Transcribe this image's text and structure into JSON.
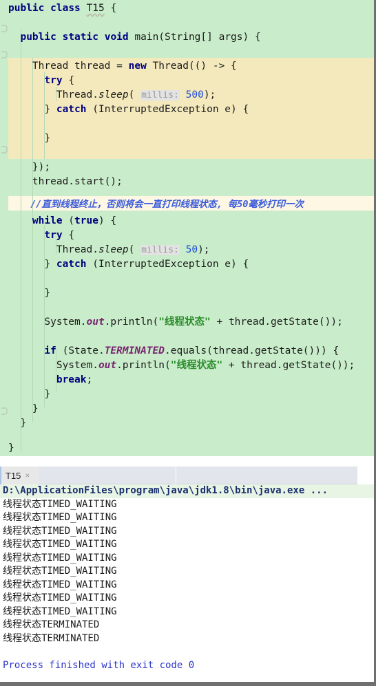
{
  "editor": {
    "background_color": "#c9ecca",
    "lambda_highlight_color": "#f4e9bd",
    "caret_line_color": "#fdf7e3",
    "lines": [
      {
        "id": "l1",
        "text": "public class T15 {"
      },
      {
        "id": "l2",
        "text": ""
      },
      {
        "id": "l3",
        "text": "  public static void main(String[] args) {"
      },
      {
        "id": "l4",
        "text": ""
      },
      {
        "id": "l5",
        "text": "    Thread thread = new Thread(() -> {"
      },
      {
        "id": "l6",
        "text": "      try {"
      },
      {
        "id": "l7",
        "text": "        Thread.sleep( millis: 500);"
      },
      {
        "id": "l8",
        "text": "      } catch (InterruptedException e) {"
      },
      {
        "id": "l9",
        "text": ""
      },
      {
        "id": "l10",
        "text": "      }"
      },
      {
        "id": "l11",
        "text": ""
      },
      {
        "id": "l12",
        "text": "    });"
      },
      {
        "id": "l13",
        "text": "    thread.start();"
      },
      {
        "id": "l14",
        "text": ""
      },
      {
        "id": "l15",
        "text": "    //直到线程终止，否则将会一直打印线程状态, 每50毫秒打印一次"
      },
      {
        "id": "l16",
        "text": "    while (true) {"
      },
      {
        "id": "l17",
        "text": "      try {"
      },
      {
        "id": "l18",
        "text": "        Thread.sleep( millis: 50);"
      },
      {
        "id": "l19",
        "text": "      } catch (InterruptedException e) {"
      },
      {
        "id": "l20",
        "text": ""
      },
      {
        "id": "l21",
        "text": "      }"
      },
      {
        "id": "l22",
        "text": ""
      },
      {
        "id": "l23",
        "text": "      System.out.println(\"线程状态\" + thread.getState());"
      },
      {
        "id": "l24",
        "text": ""
      },
      {
        "id": "l25",
        "text": "      if (State.TERMINATED.equals(thread.getState())) {"
      },
      {
        "id": "l26",
        "text": "        System.out.println(\"线程状态\" + thread.getState());"
      },
      {
        "id": "l27",
        "text": "        break;"
      },
      {
        "id": "l28",
        "text": "      }"
      },
      {
        "id": "l29",
        "text": "    }"
      },
      {
        "id": "l30",
        "text": "  }"
      },
      {
        "id": "l31",
        "text": ""
      },
      {
        "id": "l32",
        "text": "}"
      }
    ],
    "tokens": {
      "kw_public": "public",
      "kw_class": "class",
      "kw_static": "static",
      "kw_void": "void",
      "kw_new": "new",
      "kw_try": "try",
      "kw_catch": "catch",
      "kw_while": "while",
      "kw_true": "true",
      "kw_if": "if",
      "kw_break": "break",
      "type_T15": "T15",
      "type_String": "String[]",
      "id_args": "args",
      "type_Thread": "Thread",
      "id_thread": "thread",
      "m_sleep": "sleep",
      "hint_millis": "millis:",
      "num_500": "500",
      "num_50": "50",
      "type_InterruptedException": "InterruptedException",
      "id_e": "e",
      "m_start": "start",
      "comment_line": "//直到线程终止，否则将会一直打印线程状态, 每50毫秒打印一次",
      "type_System": "System",
      "fld_out": "out",
      "m_println": "println",
      "str_state": "\"线程状态\"",
      "m_getState": "getState",
      "type_State": "State",
      "fld_TERMINATED": "TERMINATED",
      "m_equals": "equals"
    }
  },
  "console": {
    "tab": {
      "label": "T15",
      "close_icon": "×"
    },
    "command_line": "D:\\ApplicationFiles\\program\\java\\jdk1.8\\bin\\java.exe ...",
    "output_lines": [
      {
        "prefix": "线程状态",
        "state": "TIMED_WAITING"
      },
      {
        "prefix": "线程状态",
        "state": "TIMED_WAITING"
      },
      {
        "prefix": "线程状态",
        "state": "TIMED_WAITING"
      },
      {
        "prefix": "线程状态",
        "state": "TIMED_WAITING"
      },
      {
        "prefix": "线程状态",
        "state": "TIMED_WAITING"
      },
      {
        "prefix": "线程状态",
        "state": "TIMED_WAITING"
      },
      {
        "prefix": "线程状态",
        "state": "TIMED_WAITING"
      },
      {
        "prefix": "线程状态",
        "state": "TIMED_WAITING"
      },
      {
        "prefix": "线程状态",
        "state": "TIMED_WAITING"
      },
      {
        "prefix": "线程状态",
        "state": "TERMINATED"
      },
      {
        "prefix": "线程状态",
        "state": "TERMINATED"
      }
    ],
    "exit_message": "Process finished with exit code 0",
    "command_line_color": "#1b2f6e",
    "exit_message_color": "#2b36c8"
  }
}
